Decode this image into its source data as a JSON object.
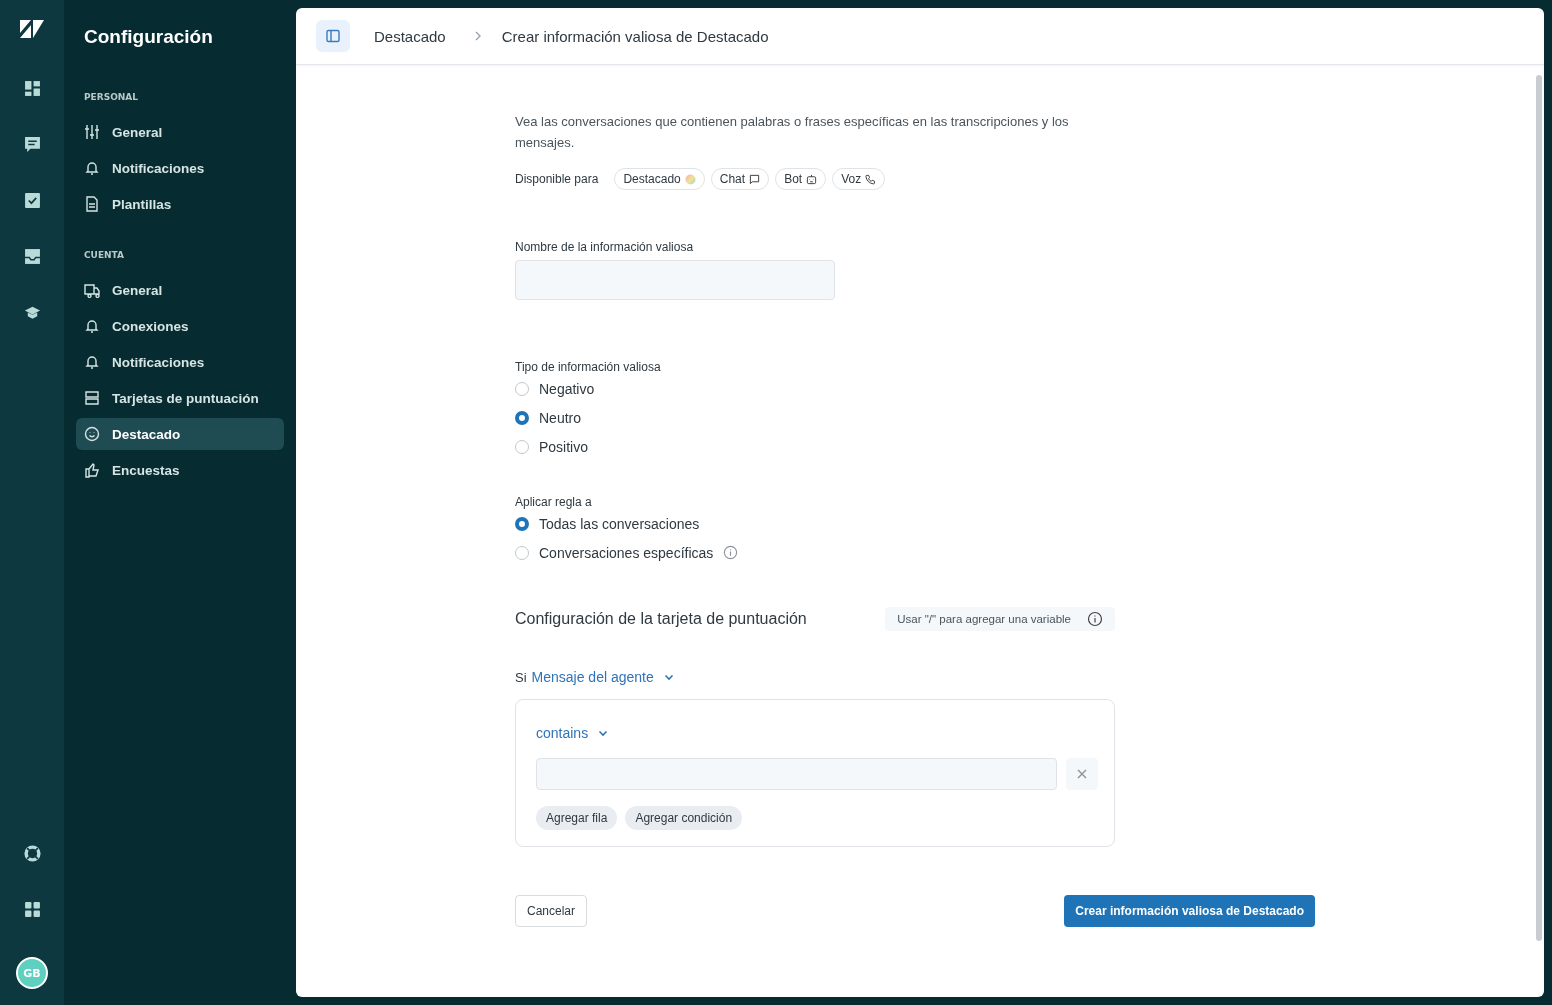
{
  "rail": {
    "avatar": "GB"
  },
  "sidebar": {
    "title": "Configuración",
    "sections": [
      {
        "heading": "PERSONAL",
        "items": [
          {
            "label": "General",
            "selected": false
          },
          {
            "label": "Notificaciones",
            "selected": false
          },
          {
            "label": "Plantillas",
            "selected": false
          }
        ]
      },
      {
        "heading": "CUENTA",
        "items": [
          {
            "label": "General",
            "selected": false
          },
          {
            "label": "Conexiones",
            "selected": false
          },
          {
            "label": "Notificaciones",
            "selected": false
          },
          {
            "label": "Tarjetas de puntuación",
            "selected": false
          },
          {
            "label": "Destacado",
            "selected": true
          },
          {
            "label": "Encuestas",
            "selected": false
          }
        ]
      }
    ]
  },
  "breadcrumb": [
    "Destacado",
    "Crear información valiosa de Destacado"
  ],
  "form": {
    "description": "Vea las conversaciones que contienen palabras o frases específicas en las transcripciones y los mensajes.",
    "available_label": "Disponible para",
    "channels": [
      "Destacado",
      "Chat",
      "Bot",
      "Voz"
    ],
    "name_label": "Nombre de la información valiosa",
    "type_label": "Tipo de información valiosa",
    "types": [
      {
        "label": "Negativo",
        "selected": false
      },
      {
        "label": "Neutro",
        "selected": true
      },
      {
        "label": "Positivo",
        "selected": false
      }
    ],
    "apply_label": "Aplicar regla a",
    "apply": [
      {
        "label": "Todas las conversaciones",
        "selected": true,
        "info": false
      },
      {
        "label": "Conversaciones específicas",
        "selected": false,
        "info": true
      }
    ],
    "scorecard_title": "Configuración de la tarjeta de puntuación",
    "variable_hint": "Usar \"/\" para agregar una variable",
    "if_label": "Si",
    "subject": "Mensaje del agente",
    "operator": "contains",
    "add_row": "Agregar fila",
    "add_condition": "Agregar condición",
    "cancel": "Cancelar",
    "submit": "Crear información valiosa de Destacado"
  }
}
